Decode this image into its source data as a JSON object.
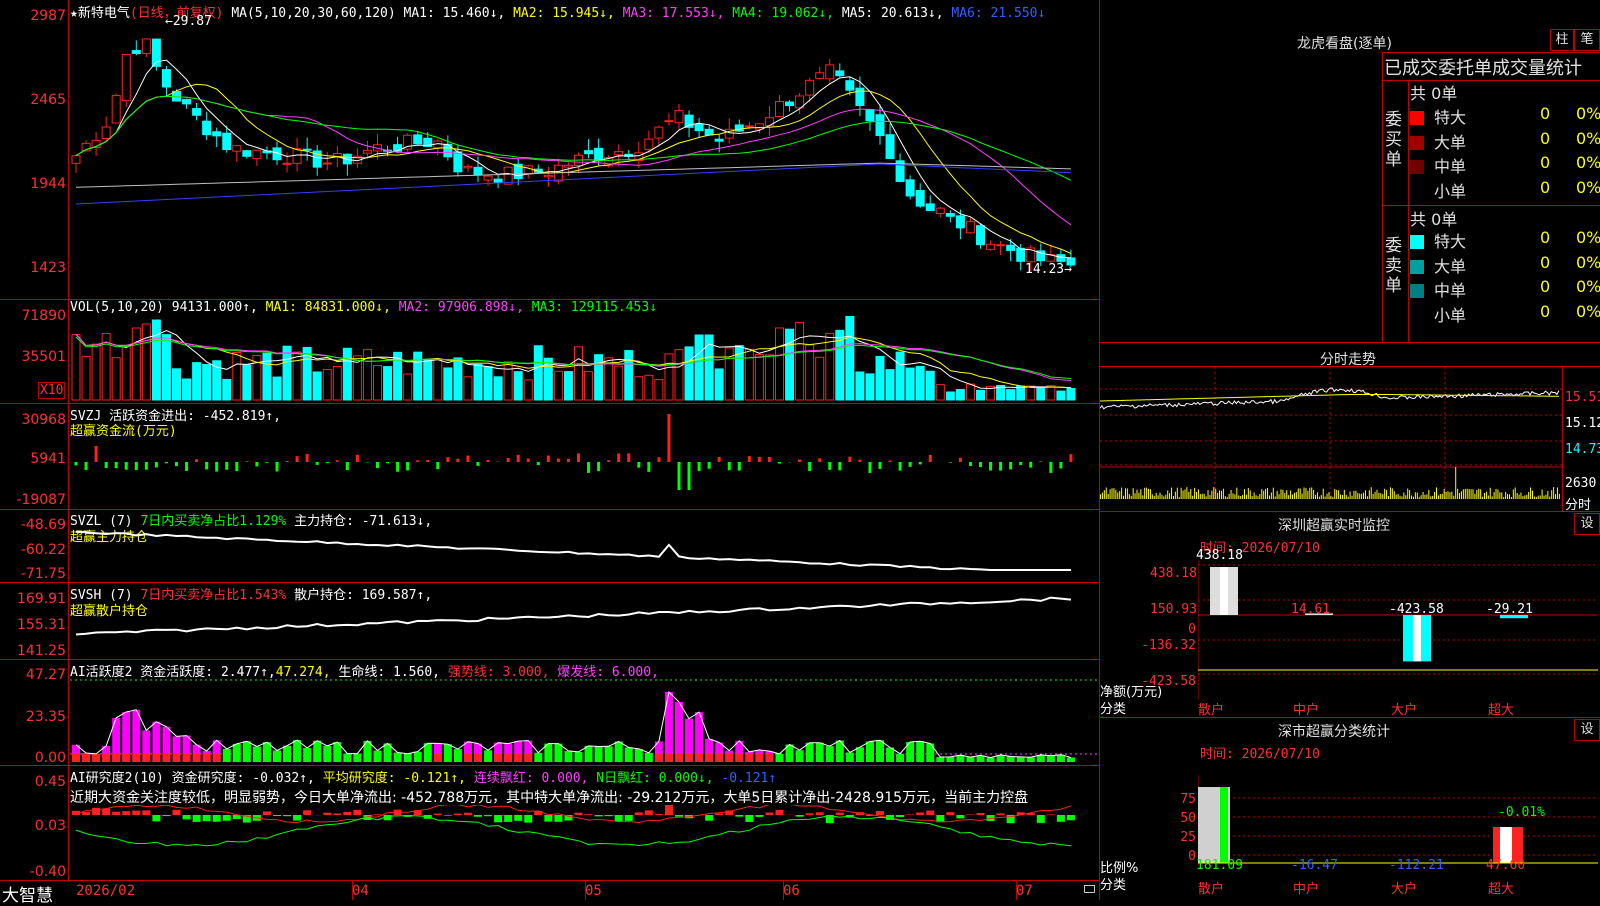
{
  "colors": {
    "up": "#ff2020",
    "down": "#00ffff",
    "ma1": "#ffffff",
    "ma2": "#ffff00",
    "ma3": "#ff40ff",
    "ma4": "#00ff00",
    "ma5": "#c0c0c0",
    "ma6": "#3040ff"
  },
  "main": {
    "stock_name": "★新特电气",
    "mode": "(日线，前复权)",
    "ma_params": "MA(5,10,20,30,60,120)",
    "ma1": "MA1: 15.460↓,",
    "ma2": "MA2: 15.945↓,",
    "ma3": "MA3: 17.553↓,",
    "ma4": "MA4: 19.062↓,",
    "ma5": "MA5: 20.613↓,",
    "ma6": "MA6: 21.550↓",
    "high_mark": "←29.87",
    "low_mark": "14.23→",
    "yticks": [
      "2987",
      "2465",
      "1944",
      "1423"
    ]
  },
  "vol": {
    "label": "VOL(5,10,20)",
    "value": "94131.000↑,",
    "ma1": "MA1: 84831.000↓,",
    "ma2": "MA2: 97906.898↓,",
    "ma3": "MA3: 129115.453↓",
    "yticks": [
      "71890",
      "35501"
    ],
    "unit": "X10"
  },
  "svzj": {
    "label": "SVZJ  活跃资金进出: -452.819↑,",
    "sub": "超赢资金流(万元)",
    "yticks": [
      "30968",
      "5941",
      "-19087"
    ]
  },
  "svzl": {
    "label1": "SVZL (7)",
    "label2": "7日内买卖净占比1.129%",
    "label3": "主力持仓: -71.613↓,",
    "sub": "超赢主力持仓",
    "yticks": [
      "-48.69",
      "-60.22",
      "-71.75"
    ]
  },
  "svsh": {
    "label1": "SVSH (7)",
    "label2": "7日内买卖净占比1.543%",
    "label3": "散户持仓: 169.587↑,",
    "sub": "超赢散户持仓",
    "yticks": [
      "169.91",
      "155.31",
      "141.25"
    ]
  },
  "aihyd": {
    "l1": "AI活跃度2 资金活跃度: 2.477↑,",
    "l2": "47.274,",
    "l3": "生命线: 1.560,",
    "l4": "强势线: 3.000,",
    "l5": "爆发线: 6.000,",
    "yticks": [
      "47.27",
      "23.35",
      "0.00"
    ]
  },
  "aiyjd": {
    "l1": "AI研究度2(10) 资金研究度: -0.032↑,",
    "l2": "平均研究度: -0.121↑,",
    "l3": "连续飘红: 0.000,",
    "l4": "N日飘红: 0.000↓,",
    "l5": "-0.121↑",
    "comment": "近期大资金关注度较低，明显弱势，今日大单净流出: -452.788万元，其中特大单净流出: -29.212万元，大单5日累计净出-2428.915万元，当前主力控盘",
    "yticks": [
      "0.45",
      "0.03",
      "-0.40"
    ]
  },
  "xaxis": {
    "brand": "大智慧",
    "labels": [
      "2026/02",
      "04",
      "05",
      "06",
      "07"
    ]
  },
  "longhu": {
    "title": "龙虎看盘(逐单)",
    "btn_bar": "柱",
    "btn_pen": "笔",
    "header": "已成交委托单成交量统计",
    "buy_side": "委买单",
    "sell_side": "委卖单",
    "buy_total": "共 0单",
    "sell_total": "共 0单",
    "buy_rows": [
      {
        "name": "特大",
        "count": "0",
        "pct": "0%",
        "color": "#ff0000"
      },
      {
        "name": "大单",
        "count": "0",
        "pct": "0%",
        "color": "#a00000"
      },
      {
        "name": "中单",
        "count": "0",
        "pct": "0%",
        "color": "#700000"
      },
      {
        "name": "小单",
        "count": "0",
        "pct": "0%",
        "color": ""
      }
    ],
    "sell_rows": [
      {
        "name": "特大",
        "count": "0",
        "pct": "0%",
        "color": "#00ffff"
      },
      {
        "name": "大单",
        "count": "0",
        "pct": "0%",
        "color": "#00a0a0"
      },
      {
        "name": "中单",
        "count": "0",
        "pct": "0%",
        "color": "#008080"
      },
      {
        "name": "小单",
        "count": "0",
        "pct": "0%",
        "color": ""
      }
    ]
  },
  "intraday": {
    "title": "分时走势",
    "prices": [
      "15.51",
      "15.12",
      "14.73"
    ],
    "vol_label": "2630",
    "vol_unit": "分时"
  },
  "sz_monitor": {
    "title": "深圳超赢实时监控",
    "btn": "设",
    "time": "时间: 2026/07/10",
    "yticks": [
      "438.18",
      "150.93",
      "0",
      "-136.32",
      "-423.58"
    ],
    "ylabel": "净额(万元)",
    "xlabel": "分类",
    "cats": [
      "散户",
      "中户",
      "大户",
      "超大"
    ],
    "values": [
      "438.18",
      "14.61",
      "-423.58",
      "-29.21"
    ],
    "nums": [
      438.18,
      14.61,
      -423.58,
      -29.21
    ]
  },
  "sz_class": {
    "title": "深市超赢分类统计",
    "btn": "设",
    "time": "时间: 2026/07/10",
    "yticks": [
      "75",
      "50",
      "25",
      "0"
    ],
    "ylabel": "比例%",
    "xlabel": "分类",
    "cats": [
      "散户",
      "中户",
      "大户",
      "超大"
    ],
    "values": [
      "181.09",
      "-16.47",
      "-112.21",
      "47.60"
    ],
    "top_label": "-0.01%"
  }
}
